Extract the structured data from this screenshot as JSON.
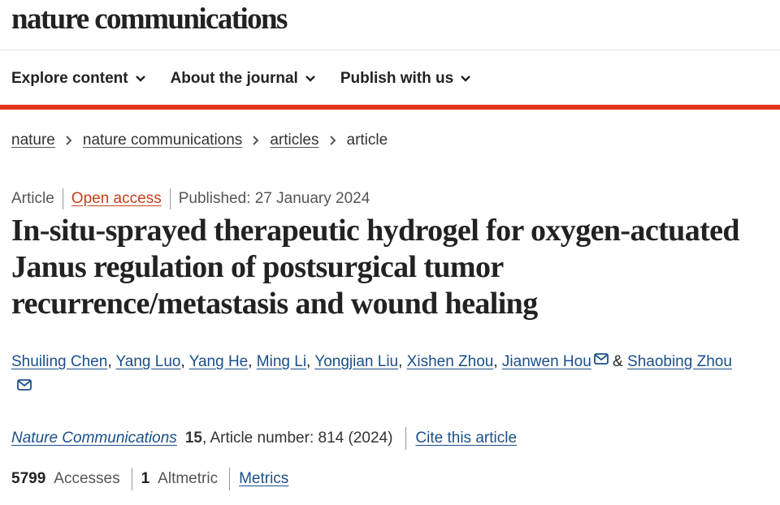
{
  "site": {
    "logo_text": "nature communications"
  },
  "nav": {
    "items": [
      {
        "label": "Explore content",
        "icon": "chevron-down-icon"
      },
      {
        "label": "About the journal",
        "icon": "chevron-down-icon"
      },
      {
        "label": "Publish with us",
        "icon": "chevron-down-icon"
      }
    ]
  },
  "breadcrumb": {
    "items": [
      "nature",
      "nature communications",
      "articles"
    ],
    "current": "article",
    "separator_icon": "chevron-right-icon"
  },
  "article": {
    "type": "Article",
    "access": "Open access",
    "published": "Published: 27 January 2024",
    "title": "In-situ-sprayed therapeutic hydrogel for oxygen-actuated Janus regulation of postsurgical tumor recurrence/metastasis and wound healing",
    "authors": [
      "Shuiling Chen",
      "Yang Luo",
      "Yang He",
      "Ming Li",
      "Yongjian Liu",
      "Xishen Zhou",
      "Jianwen Hou",
      "Shaobing Zhou"
    ],
    "author_joiner": "&",
    "corresponding_icon": "mail-icon",
    "citation": {
      "journal": "Nature Communications",
      "volume": "15",
      "article_number": ", Article number: 814 (2024)",
      "cite_label": "Cite this article"
    },
    "metrics": {
      "accesses_value": "5799",
      "accesses_label": "Accesses",
      "altmetric_value": "1",
      "altmetric_label": "Altmetric",
      "metrics_link": "Metrics"
    }
  },
  "colors": {
    "accent_red": "#e2361c",
    "link_blue": "#1a4f8b",
    "open_access": "#c4421a"
  }
}
